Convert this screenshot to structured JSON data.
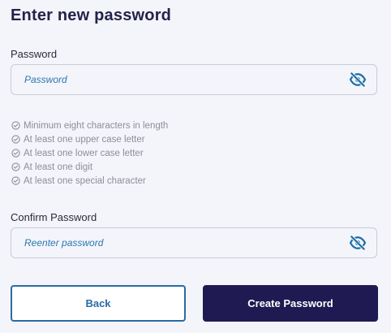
{
  "page": {
    "title": "Enter new password"
  },
  "password": {
    "label": "Password",
    "placeholder": "Password",
    "value": "",
    "toggle_icon": "eye-slash-icon"
  },
  "requirements": {
    "icon": "check-circle-icon",
    "items": [
      "Minimum eight characters in length",
      "At least one upper case letter",
      "At least one lower case letter",
      "At least one digit",
      "At least one special character"
    ]
  },
  "confirm": {
    "label": "Confirm Password",
    "placeholder": "Reenter password",
    "value": "",
    "toggle_icon": "eye-slash-icon"
  },
  "actions": {
    "back_label": "Back",
    "create_label": "Create Password"
  },
  "colors": {
    "background": "#f4f5fa",
    "primary_dark": "#1f1b52",
    "accent_blue": "#2a6aa4",
    "muted_text": "#8c8f99"
  }
}
